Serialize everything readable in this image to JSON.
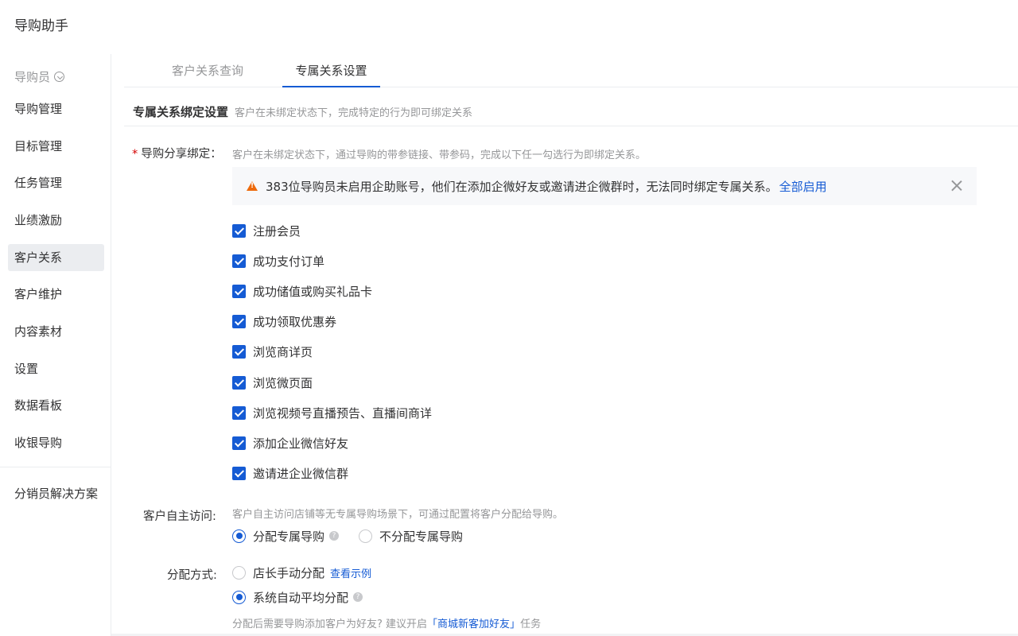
{
  "app": {
    "title": "导购助手"
  },
  "sidebar": {
    "group_label": "导购员",
    "items": [
      {
        "label": "导购管理"
      },
      {
        "label": "目标管理"
      },
      {
        "label": "任务管理"
      },
      {
        "label": "业绩激励"
      },
      {
        "label": "客户关系",
        "active": true
      },
      {
        "label": "客户维护"
      },
      {
        "label": "内容素材"
      },
      {
        "label": "设置"
      },
      {
        "label": "数据看板"
      },
      {
        "label": "收银导购"
      }
    ],
    "extra_item": "分销员解决方案"
  },
  "tabs": [
    {
      "label": "客户关系查询"
    },
    {
      "label": "专属关系设置",
      "active": true
    }
  ],
  "section": {
    "title": "专属关系绑定设置",
    "desc": "客户在未绑定状态下，完成特定的行为即可绑定关系"
  },
  "share_binding": {
    "label": "导购分享绑定：",
    "help": "客户在未绑定状态下，通过导购的带参链接、带参码，完成以下任一勾选行为即绑定关系。",
    "notice": {
      "text": "383位导购员未启用企助账号，他们在添加企微好友或邀请进企微群时，无法同时绑定专属关系。",
      "action": "全部启用"
    },
    "options": [
      {
        "label": "注册会员",
        "checked": true
      },
      {
        "label": "成功支付订单",
        "checked": true
      },
      {
        "label": "成功储值或购买礼品卡",
        "checked": true
      },
      {
        "label": "成功领取优惠券",
        "checked": true
      },
      {
        "label": "浏览商详页",
        "checked": true
      },
      {
        "label": "浏览微页面",
        "checked": true
      },
      {
        "label": "浏览视频号直播预告、直播间商详",
        "checked": true
      },
      {
        "label": "添加企业微信好友",
        "checked": true
      },
      {
        "label": "邀请进企业微信群",
        "checked": true
      }
    ]
  },
  "self_visit": {
    "label": "客户自主访问:",
    "help": "客户自主访问店铺等无专属导购场景下，可通过配置将客户分配给导购。",
    "options": [
      {
        "label": "分配专属导购",
        "selected": true
      },
      {
        "label": "不分配专属导购",
        "selected": false
      }
    ]
  },
  "assign_method": {
    "label": "分配方式:",
    "options": [
      {
        "label": "店长手动分配",
        "selected": false,
        "link": "查看示例"
      },
      {
        "label": "系统自动平均分配",
        "selected": true
      }
    ],
    "tip_prefix": "分配后需要导购添加客户为好友? 建议开启",
    "tip_link": "「商城新客加好友」",
    "tip_suffix": "任务"
  },
  "colors": {
    "primary": "#155bd4",
    "warning": "#ed6a0c",
    "required": "#d40000"
  }
}
